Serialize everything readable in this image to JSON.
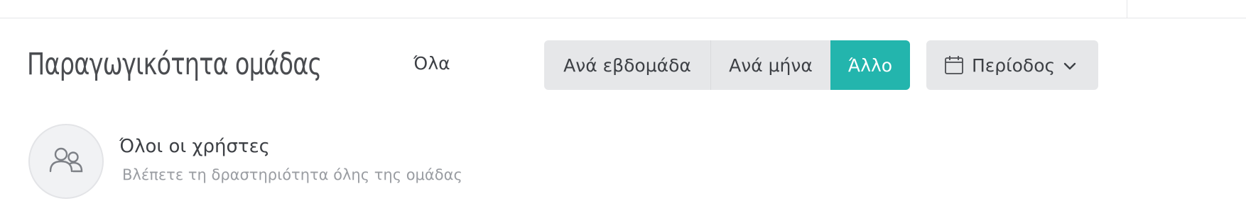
{
  "header": {
    "title": "Παραγωγικότητα ομάδας",
    "filter_all_label": "Όλα"
  },
  "range_toggle": {
    "options": [
      {
        "label": "Ανά εβδομάδα",
        "selected": false
      },
      {
        "label": "Ανά μήνα",
        "selected": false
      },
      {
        "label": "Άλλο",
        "selected": true
      }
    ]
  },
  "period": {
    "label": "Περίοδος",
    "icon": "calendar-icon",
    "dropdown_icon": "chevron-down-icon"
  },
  "user_scope": {
    "name": "Όλοι οι χρήστες",
    "description": "Βλέπετε τη δραστηριότητα όλης της ομάδας",
    "icon": "users-icon"
  },
  "colors": {
    "accent": "#23b5ad",
    "button_bg": "#e6e7e9",
    "text": "#3d4045",
    "muted_text": "#9a9da2"
  }
}
